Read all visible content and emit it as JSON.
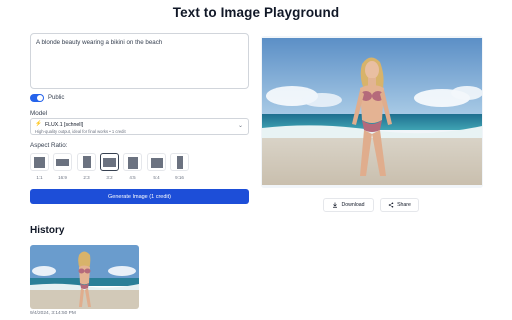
{
  "page": {
    "title": "Text to Image Playground"
  },
  "prompt": {
    "value": "A blonde beauty wearing a bikini on the beach"
  },
  "visibility": {
    "label": "Public",
    "enabled": true
  },
  "model": {
    "label": "Model",
    "selected_name": "FLUX.1 [schnell]",
    "selected_description": "High-quality output, ideal for final works • 1 credit",
    "icon": "lightning-icon"
  },
  "aspect_ratio": {
    "label": "Aspect Ratio:",
    "options": [
      "1:1",
      "16:9",
      "2:3",
      "3:2",
      "4:5",
      "5:4",
      "9:16"
    ],
    "selected": "3:2"
  },
  "generate": {
    "label": "Generate Image (1 credit)"
  },
  "actions": {
    "download_label": "Download",
    "share_label": "Share"
  },
  "history": {
    "title": "History",
    "items": [
      {
        "timestamp": "9/4/2024, 3:14:50 PM"
      }
    ]
  },
  "colors": {
    "accent": "#1d4ed8",
    "toggle_on": "#2563eb"
  }
}
